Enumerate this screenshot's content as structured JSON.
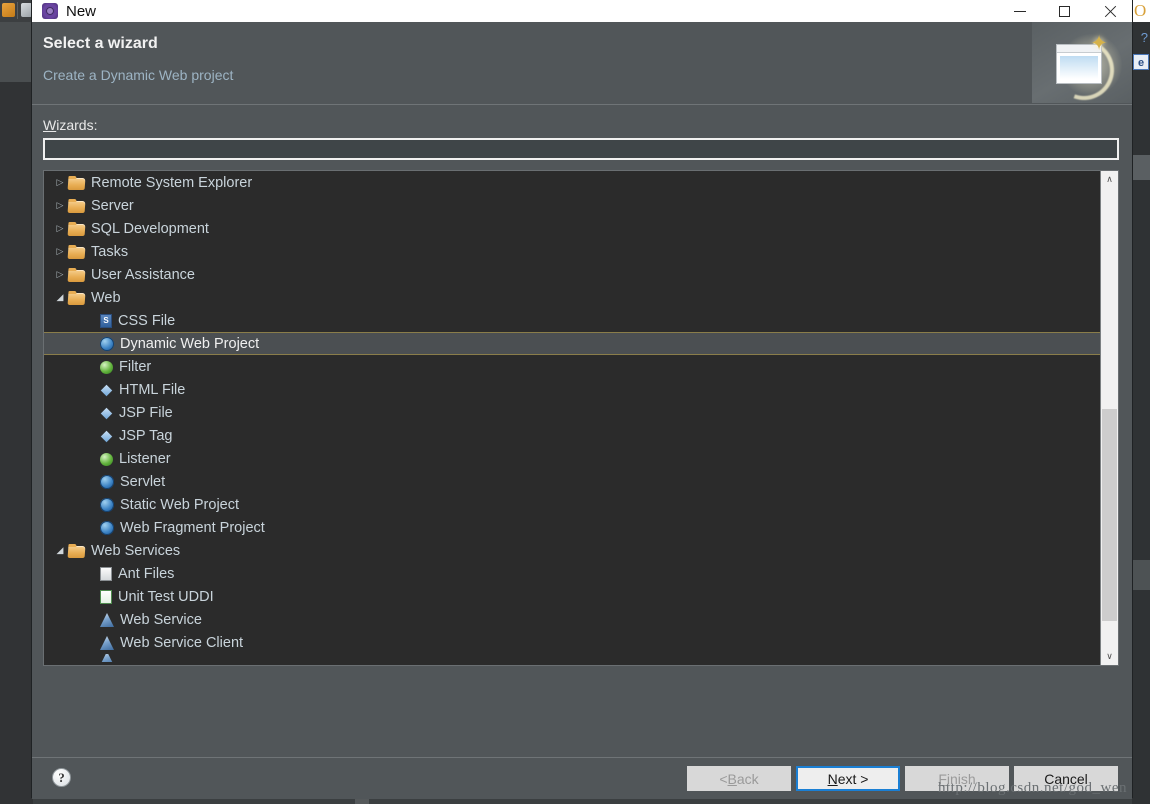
{
  "backdrop": {
    "right_o_glyph": "O",
    "right_q_glyph": "?",
    "right_e_glyph": "e"
  },
  "titlebar": {
    "title": "New",
    "icon": "eclipse-new-icon",
    "minimize_label": "",
    "maximize_label": "",
    "close_label": ""
  },
  "header": {
    "title": "Select a wizard",
    "subtitle": "Create a Dynamic Web project",
    "banner_sparkle": "✦"
  },
  "body": {
    "wizards_label_mnemonic": "W",
    "wizards_label_rest": "izards:",
    "filter": {
      "value": "",
      "placeholder": ""
    }
  },
  "tree": {
    "rows": [
      {
        "label": "Remote System Explorer",
        "indent": 0,
        "twisty": "collapsed",
        "icon": "folder-icon",
        "icon_class": "icon-folder",
        "selected": false
      },
      {
        "label": "Server",
        "indent": 0,
        "twisty": "collapsed",
        "icon": "folder-icon",
        "icon_class": "icon-folder",
        "selected": false
      },
      {
        "label": "SQL Development",
        "indent": 0,
        "twisty": "collapsed",
        "icon": "folder-icon",
        "icon_class": "icon-folder",
        "selected": false
      },
      {
        "label": "Tasks",
        "indent": 0,
        "twisty": "collapsed",
        "icon": "folder-icon",
        "icon_class": "icon-folder",
        "selected": false
      },
      {
        "label": "User Assistance",
        "indent": 0,
        "twisty": "collapsed",
        "icon": "folder-icon",
        "icon_class": "icon-folder",
        "selected": false
      },
      {
        "label": "Web",
        "indent": 0,
        "twisty": "expanded",
        "icon": "folder-icon",
        "icon_class": "icon-folder",
        "selected": false
      },
      {
        "label": "CSS File",
        "indent": 1,
        "twisty": "none",
        "icon": "css-file-icon",
        "icon_class": "icon-css",
        "selected": false
      },
      {
        "label": "Dynamic Web Project",
        "indent": 1,
        "twisty": "none",
        "icon": "dynamic-web-project-icon",
        "icon_class": "icon-globe",
        "selected": true
      },
      {
        "label": "Filter",
        "indent": 1,
        "twisty": "none",
        "icon": "filter-icon",
        "icon_class": "icon-green",
        "selected": false
      },
      {
        "label": "HTML File",
        "indent": 1,
        "twisty": "none",
        "icon": "html-file-icon",
        "icon_class": "icon-blue-diamond",
        "selected": false
      },
      {
        "label": "JSP File",
        "indent": 1,
        "twisty": "none",
        "icon": "jsp-file-icon",
        "icon_class": "icon-blue-diamond",
        "selected": false
      },
      {
        "label": "JSP Tag",
        "indent": 1,
        "twisty": "none",
        "icon": "jsp-tag-icon",
        "icon_class": "icon-blue-diamond",
        "selected": false
      },
      {
        "label": "Listener",
        "indent": 1,
        "twisty": "none",
        "icon": "listener-icon",
        "icon_class": "icon-green",
        "selected": false
      },
      {
        "label": "Servlet",
        "indent": 1,
        "twisty": "none",
        "icon": "servlet-icon",
        "icon_class": "icon-globe",
        "selected": false
      },
      {
        "label": "Static Web Project",
        "indent": 1,
        "twisty": "none",
        "icon": "static-web-project-icon",
        "icon_class": "icon-globe",
        "selected": false
      },
      {
        "label": "Web Fragment Project",
        "indent": 1,
        "twisty": "none",
        "icon": "web-fragment-project-icon",
        "icon_class": "icon-globe",
        "selected": false
      },
      {
        "label": "Web Services",
        "indent": 0,
        "twisty": "expanded",
        "icon": "folder-icon",
        "icon_class": "icon-folder",
        "selected": false
      },
      {
        "label": "Ant Files",
        "indent": 1,
        "twisty": "none",
        "icon": "ant-files-icon",
        "icon_class": "icon-scroll",
        "selected": false
      },
      {
        "label": "Unit Test UDDI",
        "indent": 1,
        "twisty": "none",
        "icon": "unit-test-uddi-icon",
        "icon_class": "icon-list",
        "selected": false
      },
      {
        "label": "Web Service",
        "indent": 1,
        "twisty": "none",
        "icon": "web-service-icon",
        "icon_class": "icon-wsvc",
        "selected": false
      },
      {
        "label": "Web Service Client",
        "indent": 1,
        "twisty": "none",
        "icon": "web-service-client-icon",
        "icon_class": "icon-wsvc",
        "selected": false
      }
    ],
    "twisty_collapsed_glyph": "▷",
    "twisty_expanded_glyph": "◢",
    "scrollbar": {
      "up_glyph": "∧",
      "down_glyph": "∨"
    }
  },
  "footer": {
    "help_glyph": "?",
    "buttons": [
      {
        "name": "back-button",
        "mnemonic_pre": "< ",
        "mnemonic": "B",
        "mnemonic_post": "ack",
        "disabled": true,
        "default": false
      },
      {
        "name": "next-button",
        "mnemonic_pre": "",
        "mnemonic": "N",
        "mnemonic_post": "ext >",
        "disabled": false,
        "default": true
      },
      {
        "name": "finish-button",
        "mnemonic_pre": "",
        "mnemonic": "F",
        "mnemonic_post": "inish",
        "disabled": true,
        "default": false
      },
      {
        "name": "cancel-button",
        "mnemonic_pre": "",
        "mnemonic": "",
        "mnemonic_post": "Cancel",
        "disabled": false,
        "default": false
      }
    ],
    "watermark": "http://blog.csdn.net/god_wen"
  },
  "colors": {
    "dialog_bg": "#515659",
    "tree_bg": "#2b2b2b",
    "selection_bg": "#4b4f52",
    "selection_border": "#8a7d4a",
    "subtitle": "#9db4c4",
    "default_button_border": "#1a7fd4"
  }
}
